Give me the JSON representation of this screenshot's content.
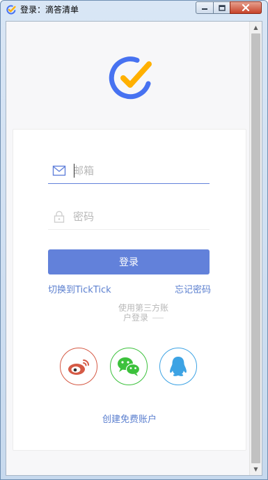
{
  "window": {
    "title": "登录：滴答清单"
  },
  "colors": {
    "accent": "#6281da",
    "logo_blue": "#4772f1",
    "logo_yellow": "#ffb000",
    "weibo": "#d55a45",
    "wechat": "#3cc13c",
    "qq": "#3da3e4"
  },
  "form": {
    "email_placeholder": "邮箱",
    "password_placeholder": "密码",
    "login_label": "登录",
    "switch_label": "切换到TickTick",
    "forgot_label": "忘记密码",
    "thirdparty_line1": "使用第三方账",
    "thirdparty_line2": "户登录",
    "create_label": "创建免费账户"
  },
  "icons": {
    "email": "mail-icon",
    "password": "lock-icon",
    "weibo": "weibo-icon",
    "wechat": "wechat-icon",
    "qq": "qq-icon"
  }
}
